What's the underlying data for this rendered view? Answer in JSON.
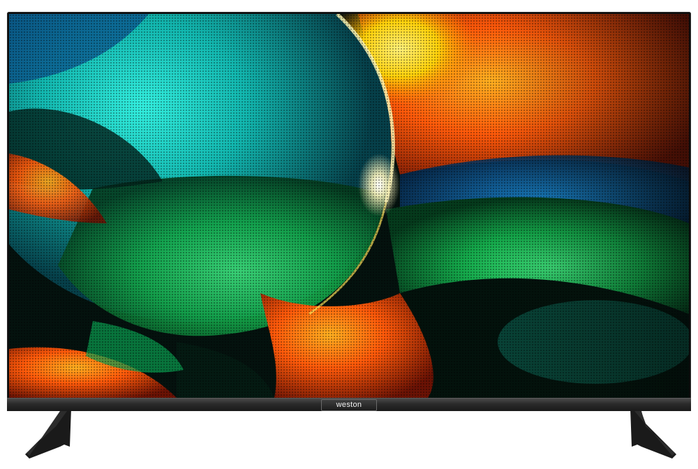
{
  "product": {
    "brand_label": "weston"
  },
  "colors": {
    "frame": "#0d0d0d",
    "bezel": "#2a2a2a",
    "stand": "#1a1a1a",
    "accent_teal": "#12c9b8",
    "accent_orange": "#ff5a0a",
    "accent_yellow": "#ffe11a",
    "accent_green": "#1fc65a"
  },
  "icons": {
    "left_stand": "stand-leg-icon",
    "right_stand": "stand-leg-icon"
  }
}
